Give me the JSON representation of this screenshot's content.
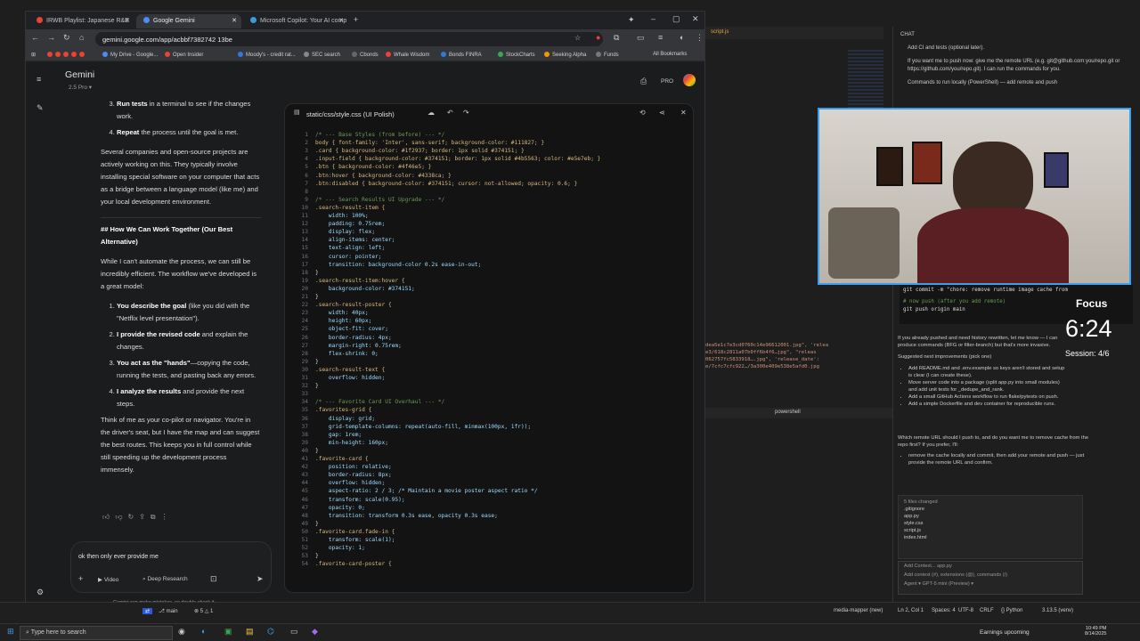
{
  "browser": {
    "tabs": [
      {
        "label": "IRWB Playlist: Japanese R&B",
        "active": false,
        "color": "#e84335"
      },
      {
        "label": "Google Gemini",
        "active": true,
        "color": "#4b8cf5"
      },
      {
        "label": "Microsoft Copilot: Your AI comp",
        "active": false,
        "color": "#3c9bd8"
      }
    ],
    "url": "gemini.google.com/app/acbbf7382742 13be",
    "bookmarks": [
      "My Drive - Google...",
      "Open Insider",
      "Moody's - credit rat...",
      "SEC search",
      "Cbonds",
      "Whale Wisdom",
      "Bonds FINRA",
      "StockCharts",
      "Seeking Alpha",
      "Funds"
    ],
    "all_bookmarks": "All Bookmarks"
  },
  "gemini": {
    "title": "Gemini",
    "model": "2.5 Pro",
    "pro_badge": "PRO",
    "chat": {
      "top_list": [
        {
          "bold": "Run tests",
          "text": " in a terminal to see if the changes work."
        },
        {
          "bold": "Repeat",
          "text": " the process until the goal is met."
        }
      ],
      "para1": "Several companies and open-source projects are actively working on this. They typically involve installing special software on your computer that acts as a bridge between a language model (like me) and your local development environment.",
      "heading": "## How We Can Work Together (Our Best Alternative)",
      "para2": "While I can't automate the process, we can still be incredibly efficient. The workflow we've developed is a great model:",
      "steps": [
        {
          "bold": "You describe the goal",
          "text": " (like you did with the \"Netflix level presentation\")."
        },
        {
          "bold": "I provide the revised code",
          "text": " and explain the changes."
        },
        {
          "bold": "You act as the \"hands\"",
          "text": "—copying the code, running the tests, and pasting back any errors."
        },
        {
          "bold": "I analyze the results",
          "text": " and provide the next steps."
        }
      ],
      "para3": "Think of me as your co-pilot or navigator. You're in the driver's seat, but I have the map and can suggest the best routes. This keeps you in full control while still speeding up the development process immensely."
    },
    "input_text": "ok then only ever provide me",
    "video_label": "Video",
    "deep_research_label": "Deep Research",
    "disclaimer": "Gemini can make mistakes, so double-check it",
    "canvas": {
      "title": "static/css/style.css (UI Polish)",
      "lines": [
        {
          "n": 1,
          "t": "/* --- Base Styles (from before) --- */",
          "c": "c-comment"
        },
        {
          "n": 2,
          "t": "body { font-family: 'Inter', sans-serif; background-color: #111827; }",
          "c": "c-sel"
        },
        {
          "n": 3,
          "t": ".card { background-color: #1f2937; border: 1px solid #374151; }",
          "c": "c-sel"
        },
        {
          "n": 4,
          "t": ".input-field { background-color: #374151; border: 1px solid #4b5563; color: #e5e7eb; }",
          "c": "c-sel"
        },
        {
          "n": 5,
          "t": ".btn { background-color: #4f46e5; }",
          "c": "c-sel"
        },
        {
          "n": 6,
          "t": ".btn:hover { background-color: #4338ca; }",
          "c": "c-sel"
        },
        {
          "n": 7,
          "t": ".btn:disabled { background-color: #374151; cursor: not-allowed; opacity: 0.6; }",
          "c": "c-sel"
        },
        {
          "n": 8,
          "t": "",
          "c": ""
        },
        {
          "n": 9,
          "t": "/* --- Search Results UI Upgrade --- */",
          "c": "c-comment"
        },
        {
          "n": 10,
          "t": ".search-result-item {",
          "c": "c-sel"
        },
        {
          "n": 11,
          "t": "    width: 100%;",
          "c": "c-prop"
        },
        {
          "n": 12,
          "t": "    padding: 0.75rem;",
          "c": "c-prop"
        },
        {
          "n": 13,
          "t": "    display: flex;",
          "c": "c-prop"
        },
        {
          "n": 14,
          "t": "    align-items: center;",
          "c": "c-prop"
        },
        {
          "n": 15,
          "t": "    text-align: left;",
          "c": "c-prop"
        },
        {
          "n": 16,
          "t": "    cursor: pointer;",
          "c": "c-prop"
        },
        {
          "n": 17,
          "t": "    transition: background-color 0.2s ease-in-out;",
          "c": "c-prop"
        },
        {
          "n": 18,
          "t": "}",
          "c": ""
        },
        {
          "n": 19,
          "t": ".search-result-item:hover {",
          "c": "c-sel"
        },
        {
          "n": 20,
          "t": "    background-color: #374151;",
          "c": "c-prop"
        },
        {
          "n": 21,
          "t": "}",
          "c": ""
        },
        {
          "n": 22,
          "t": ".search-result-poster {",
          "c": "c-sel"
        },
        {
          "n": 23,
          "t": "    width: 40px;",
          "c": "c-prop"
        },
        {
          "n": 24,
          "t": "    height: 60px;",
          "c": "c-prop"
        },
        {
          "n": 25,
          "t": "    object-fit: cover;",
          "c": "c-prop"
        },
        {
          "n": 26,
          "t": "    border-radius: 4px;",
          "c": "c-prop"
        },
        {
          "n": 27,
          "t": "    margin-right: 0.75rem;",
          "c": "c-prop"
        },
        {
          "n": 28,
          "t": "    flex-shrink: 0;",
          "c": "c-prop"
        },
        {
          "n": 29,
          "t": "}",
          "c": ""
        },
        {
          "n": 30,
          "t": ".search-result-text {",
          "c": "c-sel"
        },
        {
          "n": 31,
          "t": "    overflow: hidden;",
          "c": "c-prop"
        },
        {
          "n": 32,
          "t": "}",
          "c": ""
        },
        {
          "n": 33,
          "t": "",
          "c": ""
        },
        {
          "n": 34,
          "t": "/* --- Favorite Card UI Overhaul --- */",
          "c": "c-comment"
        },
        {
          "n": 35,
          "t": ".favorites-grid {",
          "c": "c-sel"
        },
        {
          "n": 36,
          "t": "    display: grid;",
          "c": "c-prop"
        },
        {
          "n": 37,
          "t": "    grid-template-columns: repeat(auto-fill, minmax(100px, 1fr));",
          "c": "c-prop"
        },
        {
          "n": 38,
          "t": "    gap: 1rem;",
          "c": "c-prop"
        },
        {
          "n": 39,
          "t": "    min-height: 160px;",
          "c": "c-prop"
        },
        {
          "n": 40,
          "t": "}",
          "c": ""
        },
        {
          "n": 41,
          "t": ".favorite-card {",
          "c": "c-sel"
        },
        {
          "n": 42,
          "t": "    position: relative;",
          "c": "c-prop"
        },
        {
          "n": 43,
          "t": "    border-radius: 8px;",
          "c": "c-prop"
        },
        {
          "n": 44,
          "t": "    overflow: hidden;",
          "c": "c-prop"
        },
        {
          "n": 45,
          "t": "    aspect-ratio: 2 / 3; /* Maintain a movie poster aspect ratio */",
          "c": "c-prop"
        },
        {
          "n": 46,
          "t": "    transform: scale(0.95);",
          "c": "c-prop"
        },
        {
          "n": 47,
          "t": "    opacity: 0;",
          "c": "c-prop"
        },
        {
          "n": 48,
          "t": "    transition: transform 0.3s ease, opacity 0.3s ease;",
          "c": "c-prop"
        },
        {
          "n": 49,
          "t": "}",
          "c": ""
        },
        {
          "n": 50,
          "t": ".favorite-card.fade-in {",
          "c": "c-sel"
        },
        {
          "n": 51,
          "t": "    transform: scale(1);",
          "c": "c-prop"
        },
        {
          "n": 52,
          "t": "    opacity: 1;",
          "c": "c-prop"
        },
        {
          "n": 53,
          "t": "}",
          "c": ""
        },
        {
          "n": 54,
          "t": ".favorite-card-poster {",
          "c": "c-sel"
        }
      ]
    }
  },
  "vscode": {
    "tabs": [
      "script.js"
    ],
    "chat_title": "CHAT",
    "chat_lines": [
      "Add CI and tests (optional later).",
      "If you want me to push now: give me the remote URL (e.g. git@github.com:you/repo.git or https://github.com/you/repo.git). I can run the commands for you.",
      "Commands to run locally (PowerShell) — add remote and push"
    ],
    "code_lines": [
      "git commit -m \"chore: remove runtime image cache from",
      "# now push (after you add remote)",
      "git push origin main"
    ],
    "focus_label": "Focus",
    "focus_time": "6:24",
    "focus_session": "Session: 4/6",
    "lower_text": [
      "If you already pushed and need history rewritten, let me know — I can produce commands (BFG or filter-branch) but that's more invasive.",
      "Suggested next improvements (pick one)",
      "Add README.md and .env.example so keys aren't stored and setup is clear (I can create these).",
      "Move server code into a package (split app.py into small modules) and add unit tests for _dedupe_and_rank.",
      "Add a small GitHub Actions workflow to run flake/pytests on push.",
      "Add a simple Dockerfile and dev container for reproducible runs.",
      "Which remote URL should I push to, and do you want me to remove cache from the repo first? If you prefer, I'll:",
      "remove the cache locally and commit, then add your remote and push — just provide the remote URL and confirm."
    ],
    "files_changed": "5 files changed",
    "files": [
      ".gitignore",
      "app.py",
      "style.css",
      "script.js",
      "index.html"
    ],
    "add_context": "Add Context...",
    "add_context_file": "app.py",
    "input_placeholder": "Add context (#), extensions (@), commands (/)",
    "agent_label": "Agent",
    "model_label": "GPT-5 mini (Preview)",
    "terminal_label": "powershell"
  },
  "statusbar": {
    "branch": "main",
    "errors": "⊗ 5 △ 1",
    "right": [
      "media-mapper (new)",
      "Ln 2, Col 1",
      "Spaces: 4",
      "UTF-8",
      "CRLF",
      "{} Python",
      "3.13.5 (venv)"
    ]
  },
  "taskbar": {
    "search_placeholder": "Type here to search",
    "weather": "Earnings upcoming",
    "time": "10:49 PM",
    "date": "8/14/2025"
  }
}
